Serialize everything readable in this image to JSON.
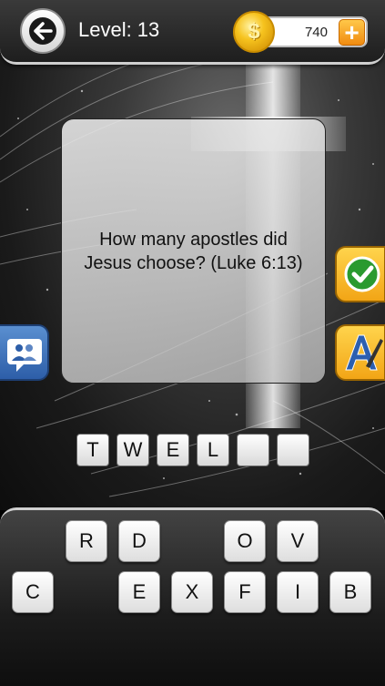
{
  "header": {
    "level_label": "Level:",
    "level_number": "13",
    "coins": "740",
    "coin_symbol": "$",
    "add_symbol": "+"
  },
  "question": {
    "text": "How many apostles did\nJesus choose? (Luke 6:13)"
  },
  "answer": {
    "slots": [
      "T",
      "W",
      "E",
      "L",
      "",
      ""
    ]
  },
  "keyboard": {
    "row1": [
      "R",
      "D",
      "",
      "",
      "O",
      "V"
    ],
    "row2": [
      "C",
      "",
      "E",
      "X",
      "F",
      "I",
      "B"
    ]
  },
  "colors": {
    "accent_orange": "#f2a516",
    "share_blue": "#2d5ea8",
    "check_green": "#1f8a28"
  },
  "icons": {
    "back": "back-arrow-icon",
    "coin": "coin-icon",
    "add": "plus-icon",
    "check": "checkmark-icon",
    "hint": "letter-hint-icon",
    "share": "share-friends-icon"
  }
}
